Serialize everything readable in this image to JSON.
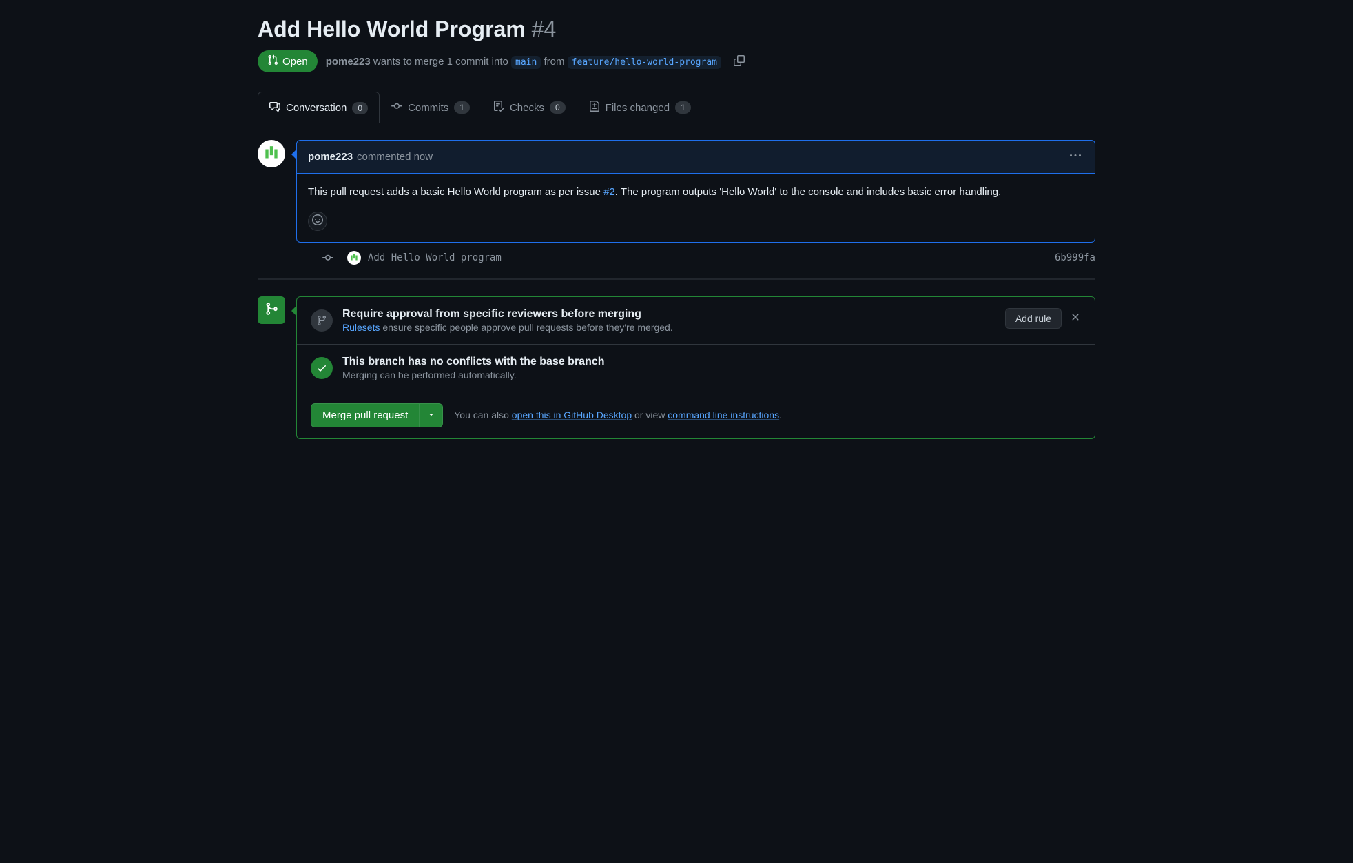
{
  "header": {
    "title": "Add Hello World Program",
    "number": "#4",
    "state_label": "Open",
    "author": "pome223",
    "meta_before": "wants to merge 1 commit into",
    "base_branch": "main",
    "meta_from": "from",
    "head_branch": "feature/hello-world-program"
  },
  "tabs": {
    "conversation": {
      "label": "Conversation",
      "count": "0"
    },
    "commits": {
      "label": "Commits",
      "count": "1"
    },
    "checks": {
      "label": "Checks",
      "count": "0"
    },
    "files": {
      "label": "Files changed",
      "count": "1"
    }
  },
  "comment": {
    "author": "pome223",
    "when": "commented now",
    "body_before": "This pull request adds a basic Hello World program as per issue ",
    "issue_link": "#2",
    "body_after": ". The program outputs 'Hello World' to the console and includes basic error handling."
  },
  "commit": {
    "message": "Add Hello World program",
    "hash": "6b999fa"
  },
  "merge": {
    "rule_suggest": {
      "title": "Require approval from specific reviewers before merging",
      "link_text": "Rulesets",
      "desc_rest": " ensure specific people approve pull requests before they're merged.",
      "add_rule_btn": "Add rule"
    },
    "conflict": {
      "title": "This branch has no conflicts with the base branch",
      "desc": "Merging can be performed automatically."
    },
    "action": {
      "merge_btn": "Merge pull request",
      "help_before": "You can also ",
      "link_desktop": "open this in GitHub Desktop",
      "help_mid": " or view ",
      "link_cli": "command line instructions",
      "help_after": "."
    }
  }
}
